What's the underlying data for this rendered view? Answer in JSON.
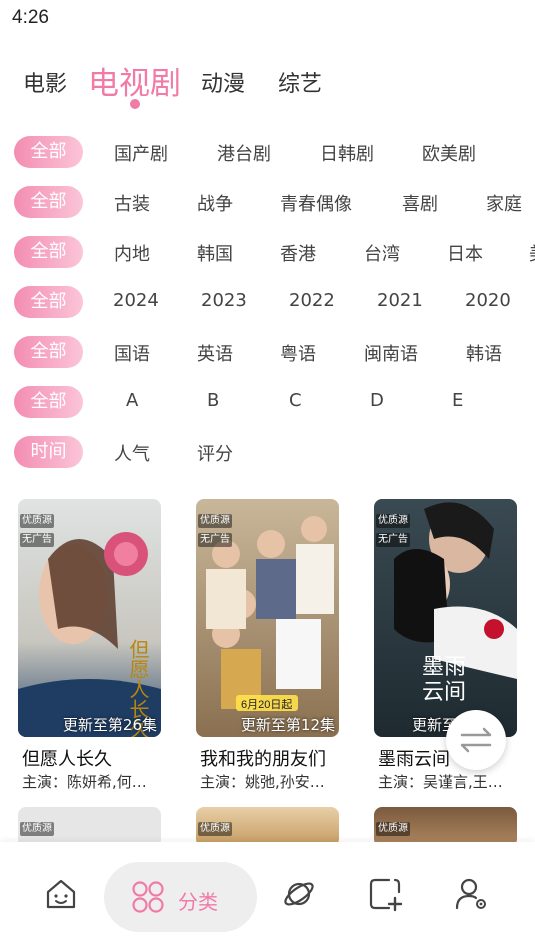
{
  "status_bar": {
    "time": "4:26"
  },
  "top_tabs": [
    {
      "label": "电影"
    },
    {
      "label": "电视剧",
      "active": true
    },
    {
      "label": "动漫"
    },
    {
      "label": "综艺"
    }
  ],
  "filters": [
    {
      "selected": "全部",
      "options": [
        "国产剧",
        "港台剧",
        "日韩剧",
        "欧美剧"
      ]
    },
    {
      "selected": "全部",
      "options": [
        "古装",
        "战争",
        "青春偶像",
        "喜剧",
        "家庭"
      ]
    },
    {
      "selected": "全部",
      "options": [
        "内地",
        "韩国",
        "香港",
        "台湾",
        "日本",
        "美"
      ]
    },
    {
      "selected": "全部",
      "options": [
        "2024",
        "2023",
        "2022",
        "2021",
        "2020"
      ]
    },
    {
      "selected": "全部",
      "options": [
        "国语",
        "英语",
        "粤语",
        "闽南语",
        "韩语"
      ]
    },
    {
      "selected": "全部",
      "options": [
        "A",
        "B",
        "C",
        "D",
        "E"
      ]
    },
    {
      "selected": "时间",
      "options": [
        "人气",
        "评分"
      ]
    }
  ],
  "cards": [
    {
      "title": "但愿人长久",
      "cast": "主演：陈妍希,何…",
      "update": "更新至第26集",
      "tags": [
        "优质源",
        "无广告"
      ],
      "poster_text": "但愿人长久",
      "poster_date": ""
    },
    {
      "title": "我和我的朋友们",
      "cast": "主演：姚弛,孙安…",
      "update": "更新至第12集",
      "tags": [
        "优质源",
        "无广告"
      ],
      "poster_text": "",
      "poster_date": "6月20日起"
    },
    {
      "title": "墨雨云间",
      "cast": "主演：吴谨言,王…",
      "update": "更新至第",
      "tags": [
        "优质源",
        "无广告"
      ],
      "poster_text": "墨雨云间",
      "poster_date": ""
    }
  ],
  "cards_row2": [
    {
      "tags": [
        "优质源"
      ]
    },
    {
      "tags": [
        "优质源"
      ]
    },
    {
      "tags": [
        "优质源"
      ]
    }
  ],
  "bottom_nav": [
    {
      "icon": "home-icon"
    },
    {
      "icon": "category-icon",
      "label": "分类",
      "active": true
    },
    {
      "icon": "planet-icon"
    },
    {
      "icon": "add-box-icon"
    },
    {
      "icon": "user-settings-icon"
    }
  ],
  "colors": {
    "accent": "#f17aa6",
    "pill_start": "#f38db1",
    "pill_end": "#fbc5d8"
  }
}
